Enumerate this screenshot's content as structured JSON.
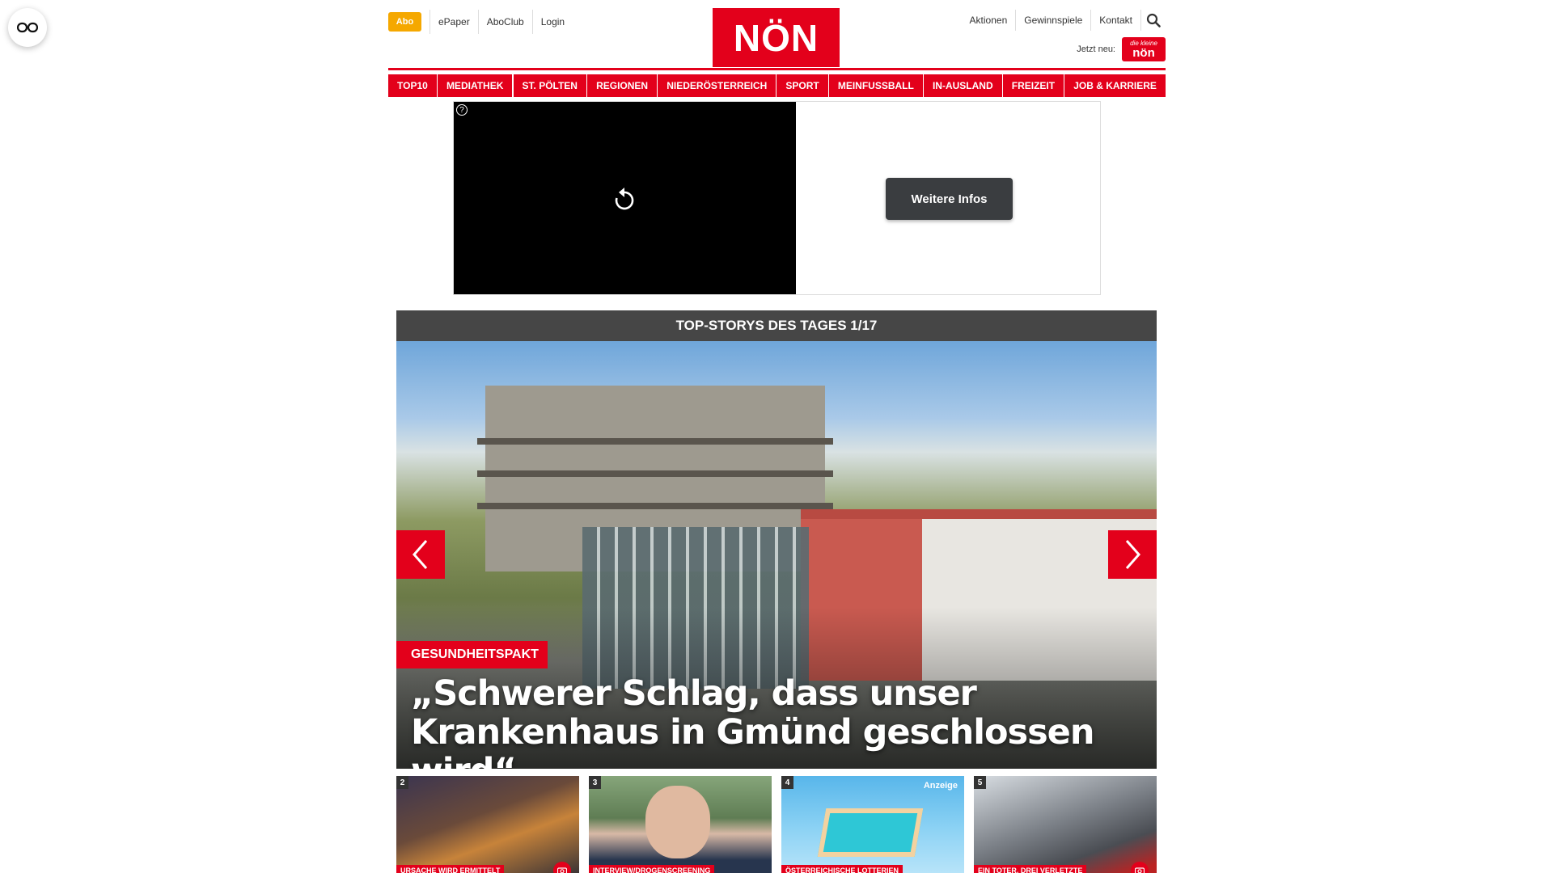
{
  "header": {
    "abo_label": "Abo",
    "left_links": [
      "ePaper",
      "AboClub",
      "Login"
    ],
    "logo_text": "NÖN",
    "right_links": [
      "Aktionen",
      "Gewinnspiele",
      "Kontakt"
    ],
    "jetzt_neu": "Jetzt neu:",
    "kleine_top": "die kleine",
    "kleine_bottom": "nön"
  },
  "nav": {
    "items": [
      "TOP10",
      "MEDIATHEK",
      "ST. PÖLTEN",
      "REGIONEN",
      "NIEDERÖSTERREICH",
      "SPORT",
      "MEINFUSSBALL",
      "IN-AUSLAND",
      "FREIZEIT",
      "JOB & KARRIERE"
    ]
  },
  "ad": {
    "help_glyph": "?",
    "button_label": "Weitere Infos"
  },
  "topstory": {
    "header": "TOP-STORYS DES TAGES 1/17",
    "tag": "GESUNDHEITSPAKT",
    "title": "„Schwerer Schlag, dass unser Krankenhaus in Gmünd geschlossen wird“"
  },
  "teasers": [
    {
      "num": "2",
      "label": "URSACHE WIRD ERMITTELT",
      "camera": true
    },
    {
      "num": "3",
      "label": "INTERVIEW/DROGENSCREENING",
      "camera": false
    },
    {
      "num": "4",
      "label": "ÖSTERREICHISCHE LOTTERIEN",
      "anzeige": "Anzeige",
      "camera": false
    },
    {
      "num": "5",
      "label": "EIN TOTER, DREI VERLETZTE",
      "camera": true
    }
  ],
  "colors": {
    "brand_red": "#e3001b",
    "abo_yellow": "#f5a800",
    "header_grey": "#464646"
  },
  "icons": {
    "accessibility": "glasses-icon",
    "search": "search-icon",
    "replay": "replay-icon",
    "prev": "chevron-left-icon",
    "next": "chevron-right-icon",
    "camera": "camera-icon"
  }
}
